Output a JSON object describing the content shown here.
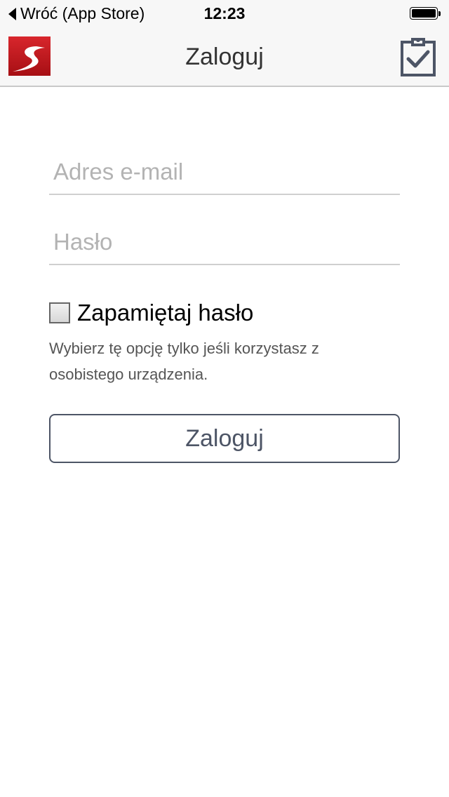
{
  "status_bar": {
    "back_label": "Wróć (App Store)",
    "time": "12:23"
  },
  "nav": {
    "title": "Zaloguj",
    "logo_icon": "red-road-logo-icon",
    "clipboard_icon": "clipboard-check-icon"
  },
  "form": {
    "email": {
      "placeholder": "Adres e-mail",
      "value": ""
    },
    "password": {
      "placeholder": "Hasło",
      "value": ""
    },
    "remember": {
      "label": "Zapamiętaj hasło",
      "checked": false
    },
    "hint": "Wybierz tę opcję tylko jeśli korzystasz z osobistego urządzenia.",
    "submit_label": "Zaloguj"
  },
  "colors": {
    "accent_red": "#c4161c",
    "button_text": "#4d5566"
  }
}
